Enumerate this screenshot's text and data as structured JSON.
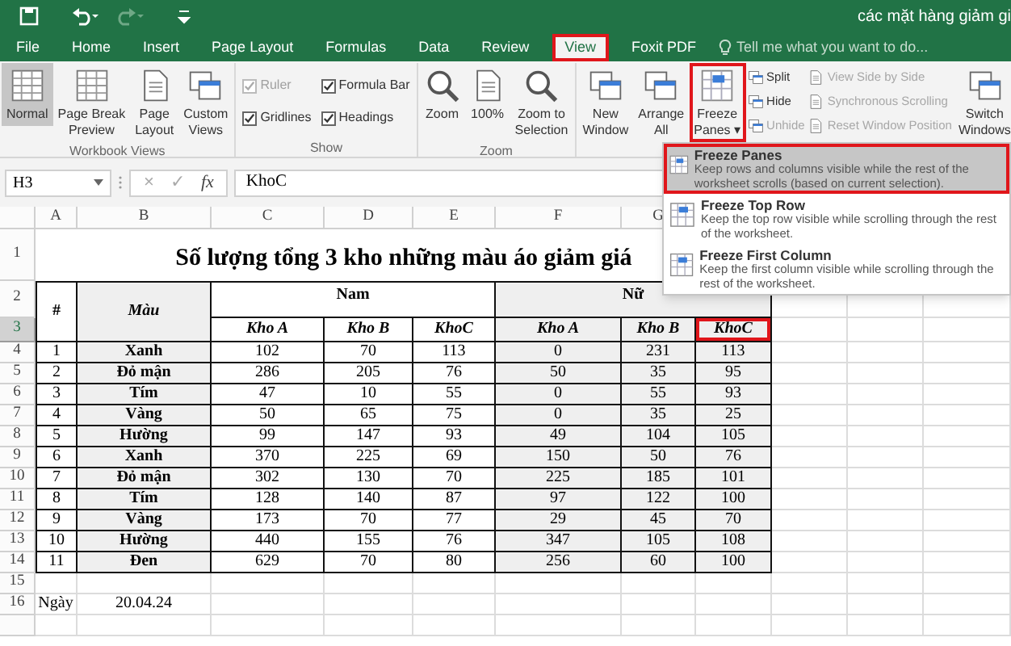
{
  "title_bar": {
    "title": "các mặt hàng giảm gi"
  },
  "tabs": [
    {
      "label": "File",
      "selected": false,
      "highlighted": false
    },
    {
      "label": "Home",
      "selected": false,
      "highlighted": false
    },
    {
      "label": "Insert",
      "selected": false,
      "highlighted": false
    },
    {
      "label": "Page Layout",
      "selected": false,
      "highlighted": false
    },
    {
      "label": "Formulas",
      "selected": false,
      "highlighted": false
    },
    {
      "label": "Data",
      "selected": false,
      "highlighted": false
    },
    {
      "label": "Review",
      "selected": false,
      "highlighted": false
    },
    {
      "label": "View",
      "selected": true,
      "highlighted": true
    },
    {
      "label": "Foxit PDF",
      "selected": false,
      "highlighted": false
    }
  ],
  "tell_me": {
    "placeholder": "Tell me what you want to do..."
  },
  "ribbon": {
    "groups": [
      {
        "label": "Workbook Views",
        "items": [
          {
            "kind": "large",
            "lines": [
              "Normal"
            ],
            "selected": true,
            "disabled": false,
            "highlighted": false
          },
          {
            "kind": "large",
            "lines": [
              "Page Break",
              "Preview"
            ],
            "selected": false,
            "disabled": false,
            "highlighted": false
          },
          {
            "kind": "large",
            "lines": [
              "Page",
              "Layout"
            ],
            "selected": false,
            "disabled": false,
            "highlighted": false
          },
          {
            "kind": "large",
            "lines": [
              "Custom",
              "Views"
            ],
            "selected": false,
            "disabled": false,
            "highlighted": false
          }
        ]
      },
      {
        "label": "Show",
        "items": [
          {
            "kind": "checkbox",
            "label": "Ruler",
            "checked": true,
            "disabled": true
          },
          {
            "kind": "checkbox",
            "label": "Gridlines",
            "checked": true,
            "disabled": false
          },
          {
            "kind": "checkbox",
            "label": "Formula Bar",
            "checked": true,
            "disabled": false
          },
          {
            "kind": "checkbox",
            "label": "Headings",
            "checked": true,
            "disabled": false
          }
        ]
      },
      {
        "label": "Zoom",
        "items": [
          {
            "kind": "large",
            "lines": [
              "Zoom"
            ],
            "selected": false,
            "disabled": false,
            "highlighted": false
          },
          {
            "kind": "large",
            "lines": [
              "100%"
            ],
            "selected": false,
            "disabled": false,
            "highlighted": false
          },
          {
            "kind": "large",
            "lines": [
              "Zoom to",
              "Selection"
            ],
            "selected": false,
            "disabled": false,
            "highlighted": false
          }
        ]
      },
      {
        "items": [
          {
            "kind": "large",
            "lines": [
              "New",
              "Window"
            ],
            "selected": false,
            "disabled": false,
            "highlighted": false
          },
          {
            "kind": "large",
            "lines": [
              "Arrange",
              "All"
            ],
            "selected": false,
            "disabled": false,
            "highlighted": false
          },
          {
            "kind": "large",
            "lines": [
              "Freeze",
              "Panes ▾"
            ],
            "selected": false,
            "disabled": false,
            "highlighted": true
          },
          {
            "kind": "small",
            "label": "Split",
            "disabled": false
          },
          {
            "kind": "small",
            "label": "Hide",
            "disabled": false
          },
          {
            "kind": "small",
            "label": "Unhide",
            "disabled": true
          },
          {
            "kind": "small",
            "label": "View Side by Side",
            "disabled": true
          },
          {
            "kind": "small",
            "label": "Synchronous Scrolling",
            "disabled": true
          },
          {
            "kind": "small",
            "label": "Reset Window Position",
            "disabled": true
          },
          {
            "kind": "large",
            "lines": [
              "Switch",
              "Windows"
            ],
            "selected": false,
            "disabled": false,
            "highlighted": false
          }
        ]
      }
    ]
  },
  "formula_bar": {
    "name_box": "H3",
    "cancel": "×",
    "enter": "✓",
    "fx": "fx",
    "value": "KhoC"
  },
  "freeze_menu": [
    {
      "title": "Freeze Panes",
      "description": "Keep rows and columns visible while the rest of the worksheet scrolls (based on current selection).",
      "selected": true,
      "highlighted": true
    },
    {
      "title": "Freeze Top Row",
      "description": "Keep the top row visible while scrolling through the rest of the worksheet.",
      "selected": false,
      "highlighted": false
    },
    {
      "title": "Freeze First Column",
      "description": "Keep the first column visible while scrolling through the rest of the worksheet.",
      "selected": false,
      "highlighted": false
    }
  ],
  "sheet": {
    "columns": [
      "A",
      "B",
      "C",
      "D",
      "E",
      "F",
      "G"
    ],
    "rows": [
      {
        "label": "1",
        "selected": false
      },
      {
        "label": "2",
        "selected": false
      },
      {
        "label": "3",
        "selected": true
      },
      {
        "label": "4",
        "selected": false
      },
      {
        "label": "5",
        "selected": false
      },
      {
        "label": "6",
        "selected": false
      },
      {
        "label": "7",
        "selected": false
      },
      {
        "label": "8",
        "selected": false
      },
      {
        "label": "9",
        "selected": false
      },
      {
        "label": "10",
        "selected": false
      },
      {
        "label": "11",
        "selected": false
      },
      {
        "label": "12",
        "selected": false
      },
      {
        "label": "13",
        "selected": false
      },
      {
        "label": "14",
        "selected": false
      },
      {
        "label": "15",
        "selected": false
      },
      {
        "label": "16",
        "selected": false
      }
    ],
    "title": "Số lượng tổng 3 kho những màu áo giảm giá",
    "index_header": "#",
    "color_header": "Màu",
    "groups": [
      "Nam",
      "Nữ"
    ],
    "subheaders": [
      {
        "text": "Kho A",
        "highlighted": false
      },
      {
        "text": "Kho B",
        "highlighted": false
      },
      {
        "text": "KhoC",
        "highlighted": false
      },
      {
        "text": "Kho A",
        "highlighted": false
      },
      {
        "text": "Kho B",
        "highlighted": false
      },
      {
        "text": "KhoC",
        "highlighted": true
      }
    ],
    "data": [
      [
        "1",
        "Xanh",
        "102",
        "70",
        "113",
        "0",
        "231",
        "113"
      ],
      [
        "2",
        "Đỏ mận",
        "286",
        "205",
        "76",
        "50",
        "35",
        "95"
      ],
      [
        "3",
        "Tím",
        "47",
        "10",
        "55",
        "0",
        "55",
        "93"
      ],
      [
        "4",
        "Vàng",
        "50",
        "65",
        "75",
        "0",
        "35",
        "25"
      ],
      [
        "5",
        "Hường",
        "99",
        "147",
        "93",
        "49",
        "104",
        "105"
      ],
      [
        "6",
        "Xanh",
        "370",
        "225",
        "69",
        "150",
        "50",
        "76"
      ],
      [
        "7",
        "Đỏ mận",
        "302",
        "130",
        "70",
        "225",
        "185",
        "101"
      ],
      [
        "8",
        "Tím",
        "128",
        "140",
        "87",
        "97",
        "122",
        "100"
      ],
      [
        "9",
        "Vàng",
        "173",
        "70",
        "77",
        "29",
        "45",
        "70"
      ],
      [
        "10",
        "Hường",
        "440",
        "155",
        "76",
        "347",
        "105",
        "108"
      ],
      [
        "11",
        "Đen",
        "629",
        "70",
        "80",
        "256",
        "60",
        "100"
      ]
    ],
    "footer": {
      "label": "Ngày",
      "value": "20.04.24"
    }
  }
}
